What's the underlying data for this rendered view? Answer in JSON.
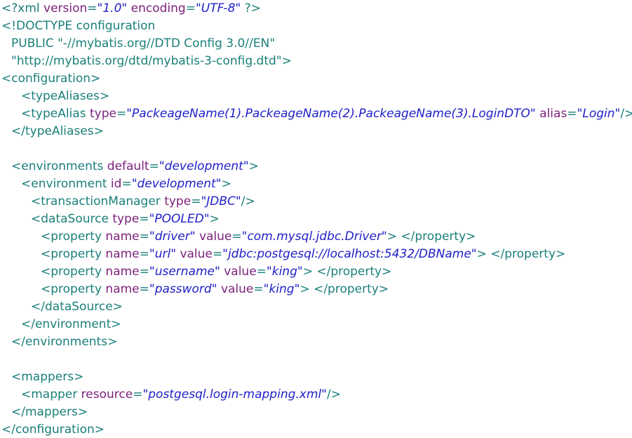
{
  "editor": {
    "lines": [
      {
        "indent": 0,
        "tokens": [
          [
            "tag",
            "<?xml "
          ],
          [
            "attr",
            "version"
          ],
          [
            "tag",
            "="
          ],
          [
            "val",
            "\"1.0\""
          ],
          [
            "tag",
            " "
          ],
          [
            "attr",
            "encoding"
          ],
          [
            "tag",
            "="
          ],
          [
            "val",
            "\"UTF-8\""
          ],
          [
            "tag",
            " ?>"
          ]
        ]
      },
      {
        "indent": 0,
        "tokens": [
          [
            "doc",
            "<!DOCTYPE configuration"
          ]
        ]
      },
      {
        "indent": 1,
        "tokens": [
          [
            "doc",
            "PUBLIC \"-//mybatis.org//DTD Config 3.0//EN\""
          ]
        ]
      },
      {
        "indent": 1,
        "tokens": [
          [
            "doc",
            "\"http://mybatis.org/dtd/mybatis-3-config.dtd\">"
          ]
        ]
      },
      {
        "indent": 0,
        "tokens": [
          [
            "tag",
            "<configuration>"
          ]
        ]
      },
      {
        "indent": 2,
        "tokens": [
          [
            "tag",
            "<typeAliases>"
          ]
        ]
      },
      {
        "indent": 2,
        "tokens": [
          [
            "tag",
            "<typeAlias "
          ],
          [
            "attr",
            "type"
          ],
          [
            "tag",
            "="
          ],
          [
            "val",
            "\"PackeageName(1).PackeageName(2).PackeageName(3).LoginDTO\""
          ],
          [
            "tag",
            " "
          ],
          [
            "attr",
            "alias"
          ],
          [
            "tag",
            "="
          ],
          [
            "val",
            "\"Login\""
          ],
          [
            "tag",
            "/>"
          ]
        ]
      },
      {
        "indent": 1,
        "tokens": [
          [
            "tag",
            "</typeAliases>"
          ]
        ]
      },
      {
        "indent": 0,
        "tokens": []
      },
      {
        "indent": 1,
        "tokens": [
          [
            "tag",
            "<environments "
          ],
          [
            "attr",
            "default"
          ],
          [
            "tag",
            "="
          ],
          [
            "val",
            "\"development\""
          ],
          [
            "tag",
            ">"
          ]
        ]
      },
      {
        "indent": 2,
        "tokens": [
          [
            "tag",
            "<environment "
          ],
          [
            "attr",
            "id"
          ],
          [
            "tag",
            "="
          ],
          [
            "val",
            "\"development\""
          ],
          [
            "tag",
            ">"
          ]
        ]
      },
      {
        "indent": 3,
        "tokens": [
          [
            "tag",
            "<transactionManager "
          ],
          [
            "attr",
            "type"
          ],
          [
            "tag",
            "="
          ],
          [
            "val",
            "\"JDBC\""
          ],
          [
            "tag",
            "/>"
          ]
        ]
      },
      {
        "indent": 3,
        "tokens": [
          [
            "tag",
            "<dataSource "
          ],
          [
            "attr",
            "type"
          ],
          [
            "tag",
            "="
          ],
          [
            "val",
            "\"POOLED\""
          ],
          [
            "tag",
            ">"
          ]
        ]
      },
      {
        "indent": 4,
        "tokens": [
          [
            "tag",
            "<property "
          ],
          [
            "attr",
            "name"
          ],
          [
            "tag",
            "="
          ],
          [
            "val",
            "\"driver\""
          ],
          [
            "tag",
            " "
          ],
          [
            "attr",
            "value"
          ],
          [
            "tag",
            "="
          ],
          [
            "val",
            "\"com.mysql.jdbc.Driver\""
          ],
          [
            "tag",
            "> </property>"
          ]
        ]
      },
      {
        "indent": 4,
        "tokens": [
          [
            "tag",
            "<property "
          ],
          [
            "attr",
            "name"
          ],
          [
            "tag",
            "="
          ],
          [
            "val",
            "\"url\""
          ],
          [
            "tag",
            " "
          ],
          [
            "attr",
            "value"
          ],
          [
            "tag",
            "="
          ],
          [
            "val",
            "\"jdbc:postgesql://localhost:5432/DBName\""
          ],
          [
            "tag",
            "> </property>"
          ]
        ]
      },
      {
        "indent": 4,
        "tokens": [
          [
            "tag",
            "<property "
          ],
          [
            "attr",
            "name"
          ],
          [
            "tag",
            "="
          ],
          [
            "val",
            "\"username\""
          ],
          [
            "tag",
            " "
          ],
          [
            "attr",
            "value"
          ],
          [
            "tag",
            "="
          ],
          [
            "val",
            "\"king\""
          ],
          [
            "tag",
            "> </property>"
          ]
        ]
      },
      {
        "indent": 4,
        "tokens": [
          [
            "tag",
            "<property "
          ],
          [
            "attr",
            "name"
          ],
          [
            "tag",
            "="
          ],
          [
            "val",
            "\"password\""
          ],
          [
            "tag",
            " "
          ],
          [
            "attr",
            "value"
          ],
          [
            "tag",
            "="
          ],
          [
            "val",
            "\"king\""
          ],
          [
            "tag",
            "> </property>"
          ]
        ]
      },
      {
        "indent": 3,
        "tokens": [
          [
            "tag",
            "</dataSource>"
          ]
        ]
      },
      {
        "indent": 2,
        "tokens": [
          [
            "tag",
            "</environment>"
          ]
        ]
      },
      {
        "indent": 1,
        "tokens": [
          [
            "tag",
            "</environments>"
          ]
        ]
      },
      {
        "indent": 0,
        "tokens": []
      },
      {
        "indent": 1,
        "tokens": [
          [
            "tag",
            "<mappers>"
          ]
        ]
      },
      {
        "indent": 2,
        "tokens": [
          [
            "tag",
            "<mapper "
          ],
          [
            "attr",
            "resource"
          ],
          [
            "tag",
            "="
          ],
          [
            "val",
            "\"postgesql.login-mapping.xml\""
          ],
          [
            "tag",
            "/>"
          ]
        ]
      },
      {
        "indent": 1,
        "tokens": [
          [
            "tag",
            "</mappers>"
          ]
        ]
      },
      {
        "indent": 0,
        "tokens": [
          [
            "tag",
            "</configuration>"
          ]
        ]
      }
    ]
  },
  "colors": {
    "tag": "#1a7f7a",
    "attribute": "#7b1f7a",
    "value": "#2020c8",
    "background": "#ffffff"
  }
}
